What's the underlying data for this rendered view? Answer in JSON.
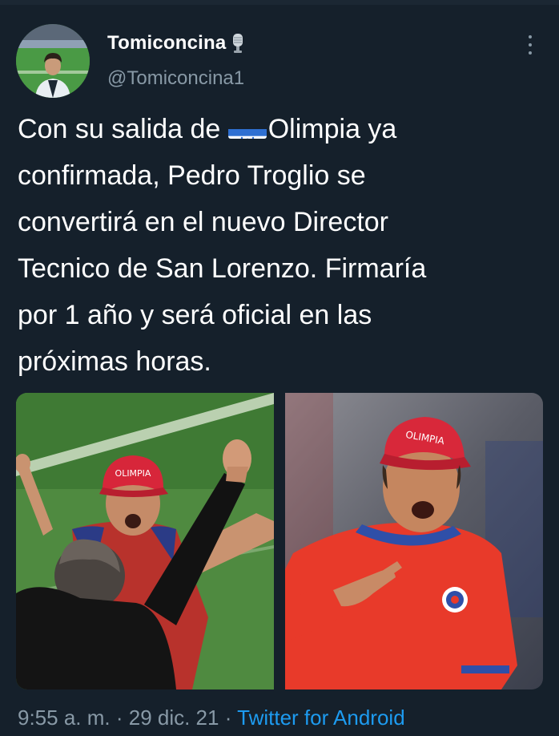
{
  "tweet": {
    "display_name": "Tomiconcina",
    "name_emoji": "microphone-icon",
    "handle": "@Tomiconcina1",
    "text_lines": [
      "Con su salida de ",
      "Olimpia ya",
      "confirmada, Pedro Troglio se",
      "convertirá en el nuevo Director",
      "Tecnico de San Lorenzo. Firmaría",
      "por 1 año y será oficial en las",
      "próximas horas."
    ],
    "flag": "honduras-flag-icon",
    "images": [
      {
        "subject": "celebrating-coach-photo",
        "cap_text": "OLIMPIA"
      },
      {
        "subject": "coach-pointing-photo",
        "cap_text": "OLIMPIA"
      }
    ],
    "time": "9:55 a. m.",
    "date": "29 dic. 21",
    "separator": " · ",
    "source": "Twitter for Android"
  },
  "colors": {
    "background": "#15202b",
    "secondary_text": "#8899a6",
    "link": "#1d9bf0",
    "text": "#ffffff"
  }
}
